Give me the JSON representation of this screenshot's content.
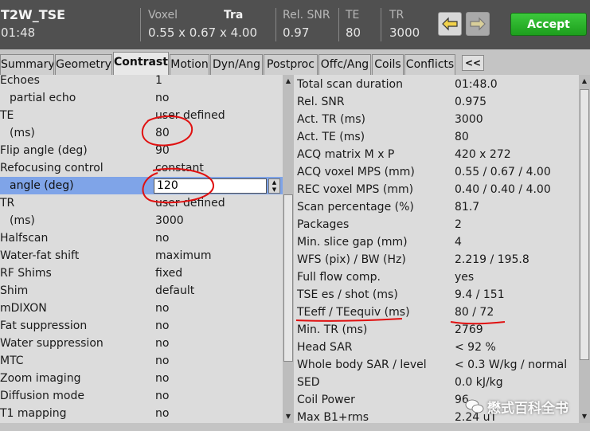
{
  "header": {
    "protocol_name": "T2W_TSE",
    "scan_duration": "01:48",
    "voxel_label": "Voxel",
    "orientation": "Tra",
    "voxel_value": "0.55 x 0.67 x 4.00",
    "snr_label": "Rel. SNR",
    "snr_value": "0.97",
    "te_label": "TE",
    "te_value": "80",
    "tr_label": "TR",
    "tr_value": "3000",
    "accept_label": "Accept"
  },
  "tabs": [
    {
      "label": "Summary"
    },
    {
      "label": "Geometry"
    },
    {
      "label": "Contrast",
      "active": true
    },
    {
      "label": "Motion"
    },
    {
      "label": "Dyn/Ang"
    },
    {
      "label": "Postproc"
    },
    {
      "label": "Offc/Ang"
    },
    {
      "label": "Coils"
    },
    {
      "label": "Conflicts"
    }
  ],
  "collapse_label": "<<",
  "params": [
    {
      "label": "Echoes",
      "value": "1"
    },
    {
      "label": "partial echo",
      "value": "no",
      "indent": true
    },
    {
      "label": "TE",
      "value": "user defined"
    },
    {
      "label": "(ms)",
      "value": "80",
      "indent": true
    },
    {
      "label": "Flip angle (deg)",
      "value": "90"
    },
    {
      "label": "Refocusing control",
      "value": "constant"
    },
    {
      "label": "angle (deg)",
      "value": "120",
      "indent": true,
      "selected": true
    },
    {
      "label": "TR",
      "value": "user defined"
    },
    {
      "label": "(ms)",
      "value": "3000",
      "indent": true
    },
    {
      "label": "Halfscan",
      "value": "no"
    },
    {
      "label": "Water-fat shift",
      "value": "maximum"
    },
    {
      "label": "RF Shims",
      "value": "fixed"
    },
    {
      "label": "Shim",
      "value": "default"
    },
    {
      "label": "mDIXON",
      "value": "no"
    },
    {
      "label": "Fat suppression",
      "value": "no"
    },
    {
      "label": "Water suppression",
      "value": "no"
    },
    {
      "label": "MTC",
      "value": "no"
    },
    {
      "label": "Zoom imaging",
      "value": "no"
    },
    {
      "label": "Diffusion mode",
      "value": "no"
    },
    {
      "label": "T1 mapping",
      "value": "no"
    }
  ],
  "info": [
    {
      "label": "Total scan duration",
      "value": "01:48.0"
    },
    {
      "label": "Rel. SNR",
      "value": "0.975"
    },
    {
      "label": "Act. TR (ms)",
      "value": "3000"
    },
    {
      "label": "Act. TE (ms)",
      "value": "80"
    },
    {
      "label": "ACQ matrix M x P",
      "value": "420 x 272"
    },
    {
      "label": "ACQ voxel MPS (mm)",
      "value": "0.55 / 0.67 / 4.00"
    },
    {
      "label": "REC voxel MPS (mm)",
      "value": "0.40 / 0.40 / 4.00"
    },
    {
      "label": "Scan percentage (%)",
      "value": "81.7"
    },
    {
      "label": "Packages",
      "value": "2"
    },
    {
      "label": "Min. slice gap (mm)",
      "value": "4"
    },
    {
      "label": "WFS (pix) / BW (Hz)",
      "value": "2.219 / 195.8"
    },
    {
      "label": "Full flow comp.",
      "value": "yes"
    },
    {
      "label": "TSE es / shot (ms)",
      "value": "9.4 / 151"
    },
    {
      "label": "TEeff / TEequiv (ms)",
      "value": "80 / 72"
    },
    {
      "label": "Min. TR (ms)",
      "value": "2769"
    },
    {
      "label": "Head SAR",
      "value": "< 92 %"
    },
    {
      "label": "Whole body SAR / level",
      "value": "< 0.3 W/kg / normal"
    },
    {
      "label": "SED",
      "value": "0.0 kJ/kg"
    },
    {
      "label": "Coil Power",
      "value": "96"
    },
    {
      "label": "Max B1+rms",
      "value": "2.24 uT"
    }
  ],
  "watermark": "懋式百科全书",
  "colors": {
    "header_bg": "#505050",
    "panel_bg": "#dcdcdc",
    "selected_row": "#7fa4e8",
    "accept_green": "#22a722",
    "annotation_red": "#e01010"
  }
}
